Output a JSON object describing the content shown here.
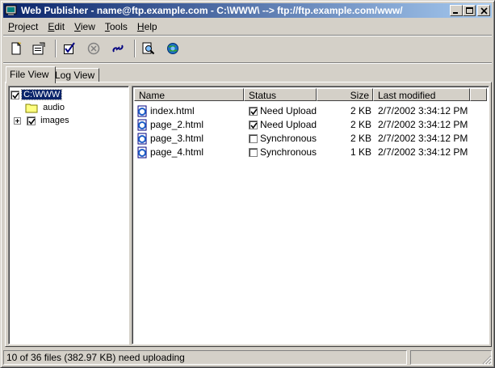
{
  "window": {
    "title": "Web Publisher - name@ftp.example.com - C:\\WWW\\ --> ftp://ftp.example.com/www/"
  },
  "menu": [
    {
      "label": "Project",
      "accel": "P",
      "rest": "roject"
    },
    {
      "label": "Edit",
      "accel": "E",
      "rest": "dit"
    },
    {
      "label": "View",
      "accel": "V",
      "rest": "iew"
    },
    {
      "label": "Tools",
      "accel": "T",
      "rest": "ools"
    },
    {
      "label": "Help",
      "accel": "H",
      "rest": "elp"
    }
  ],
  "toolbar": {
    "icons": [
      "new-document-icon",
      "properties-icon",
      "check-icon",
      "cancel-icon",
      "connect-icon",
      "find-icon",
      "publish-globe-icon"
    ]
  },
  "tabs": [
    {
      "label": "File View",
      "active": true
    },
    {
      "label": "Log View",
      "active": false
    }
  ],
  "tree": {
    "root": "C:\\WWW",
    "children": [
      {
        "label": "audio",
        "checked": false,
        "expandable": false
      },
      {
        "label": "images",
        "checked": true,
        "expandable": true
      }
    ]
  },
  "filelist": {
    "columns": [
      "Name",
      "Status",
      "Size",
      "Last modified"
    ],
    "rows": [
      {
        "name": "index.html",
        "checked": true,
        "status": "Need Upload",
        "size": "2 KB",
        "modified": "2/7/2002 3:34:12 PM"
      },
      {
        "name": "page_2.html",
        "checked": true,
        "status": "Need Upload",
        "size": "2 KB",
        "modified": "2/7/2002 3:34:12 PM"
      },
      {
        "name": "page_3.html",
        "checked": false,
        "status": "Synchronous",
        "size": "2 KB",
        "modified": "2/7/2002 3:34:12 PM"
      },
      {
        "name": "page_4.html",
        "checked": false,
        "status": "Synchronous",
        "size": "1 KB",
        "modified": "2/7/2002 3:34:12 PM"
      }
    ]
  },
  "status": {
    "message": "10 of 36 files (382.97 KB) need uploading"
  },
  "colors": {
    "title_start": "#0a246a",
    "title_end": "#a6caf0",
    "face": "#d4d0c8",
    "selection": "#0a246a"
  }
}
